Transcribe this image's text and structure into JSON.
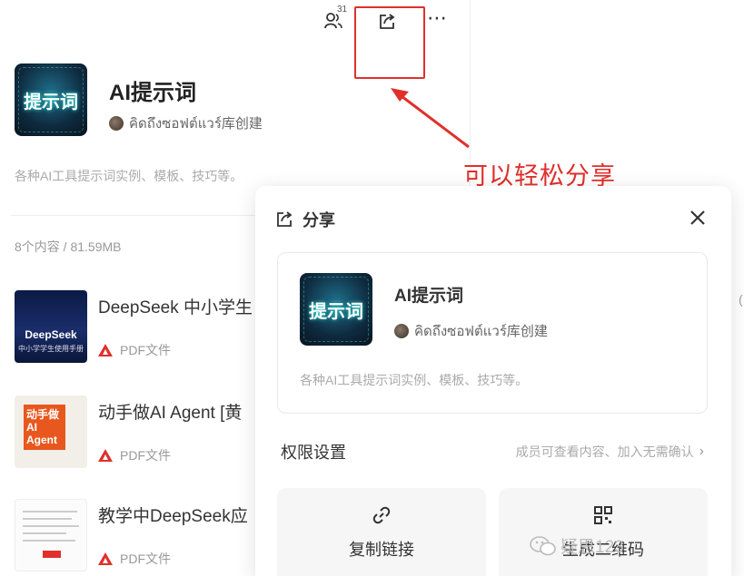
{
  "header": {
    "member_count": "31",
    "more_label": "⋯"
  },
  "knowledge_base": {
    "cover_text": "提示词",
    "title": "AI提示词",
    "creator": "คิดถึงซอฟต์แวร์库创建",
    "description": "各种AI工具提示词实例、模板、技巧等。",
    "stats": "8个内容 / 81.59MB"
  },
  "files": [
    {
      "name": "DeepSeek 中小学生",
      "type": "PDF文件",
      "thumb_title": "DeepSeek",
      "thumb_sub": "中小学学生使用手册"
    },
    {
      "name": "动手做AI Agent [黄",
      "type": "PDF文件",
      "thumb_title": "动手做 AI Agent"
    },
    {
      "name": "教学中DeepSeek应",
      "type": "PDF文件"
    }
  ],
  "annotation": {
    "text": "可以轻松分享",
    "color": "#e0302c"
  },
  "share_modal": {
    "title": "分享",
    "preview": {
      "cover_text": "提示词",
      "title": "AI提示词",
      "creator": "คิดถึงซอฟต์แวร์库创建",
      "description": "各种AI工具提示词实例、模板、技巧等。"
    },
    "permission_label": "权限设置",
    "permission_value": "成员可查看内容、加入无需确认",
    "copy_link_label": "复制链接",
    "qrcode_label": "生成二维码"
  },
  "watermark": {
    "text": "疑思123"
  },
  "edge_mark": "("
}
